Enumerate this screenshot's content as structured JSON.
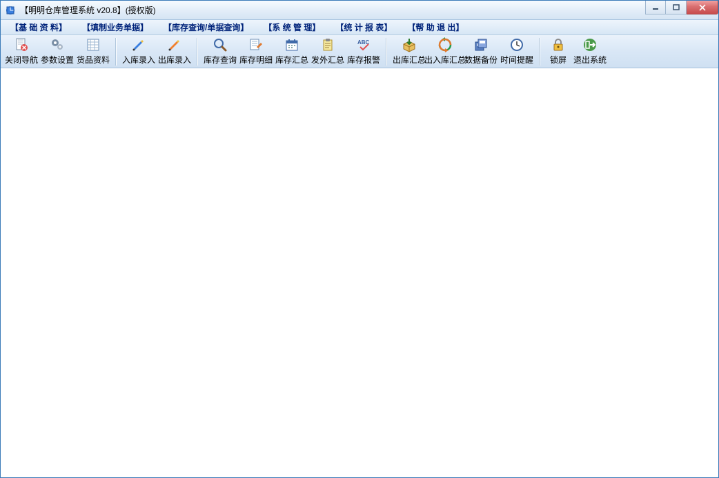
{
  "window": {
    "title": "【明明仓库管理系统 v20.8】(授权版)"
  },
  "menubar": {
    "items": [
      "【基 础 资 料】",
      "【填制业务单据】",
      "【库存查询/单据查询】",
      "【系 统 管 理】",
      "【统 计 报 表】",
      "【帮 助 退 出】"
    ]
  },
  "toolbar": {
    "group1": [
      {
        "name": "close-nav",
        "label": "关闭导航",
        "icon": "doc-x"
      },
      {
        "name": "param-settings",
        "label": "参数设置",
        "icon": "gears"
      },
      {
        "name": "product-data",
        "label": "货品资料",
        "icon": "sheet"
      }
    ],
    "group2": [
      {
        "name": "inbound-entry",
        "label": "入库录入",
        "icon": "pen-blue"
      },
      {
        "name": "outbound-entry",
        "label": "出库录入",
        "icon": "pen-orange"
      }
    ],
    "group3": [
      {
        "name": "inventory-query",
        "label": "库存查询",
        "icon": "magnifier"
      },
      {
        "name": "inventory-detail",
        "label": "库存明细",
        "icon": "list-pen"
      },
      {
        "name": "inventory-summary",
        "label": "库存汇总",
        "icon": "calendar"
      },
      {
        "name": "outgoing-summary",
        "label": "发外汇总",
        "icon": "clipboard"
      },
      {
        "name": "inventory-alert",
        "label": "库存报警",
        "icon": "abc-check"
      }
    ],
    "group4": [
      {
        "name": "outbound-summary",
        "label": "出库汇总",
        "icon": "box-out"
      },
      {
        "name": "inout-summary",
        "label": "出入库汇总",
        "icon": "recycle"
      },
      {
        "name": "data-backup",
        "label": "数据备份",
        "icon": "disks"
      },
      {
        "name": "time-reminder",
        "label": "时间提醒",
        "icon": "clock"
      }
    ],
    "group5": [
      {
        "name": "lock-screen",
        "label": "锁屏",
        "icon": "lock"
      },
      {
        "name": "exit-system",
        "label": "退出系统",
        "icon": "exit"
      }
    ]
  }
}
